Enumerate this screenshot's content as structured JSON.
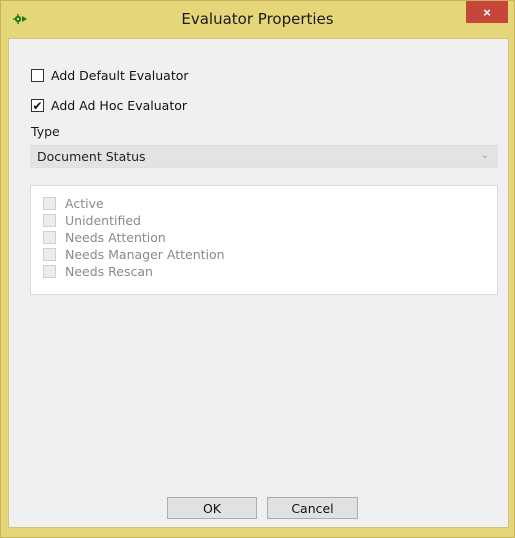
{
  "window": {
    "title": "Evaluator Properties",
    "close_label": "×"
  },
  "options": {
    "add_default_label": "Add Default Evaluator",
    "add_default_checked": false,
    "add_adhoc_label": "Add Ad Hoc Evaluator",
    "add_adhoc_checked": true,
    "check_mark": "✔"
  },
  "type_field": {
    "label": "Type",
    "selected": "Document Status",
    "chevron": "⌄"
  },
  "status_list": {
    "items": [
      {
        "label": "Active",
        "checked": false,
        "enabled": false
      },
      {
        "label": "Unidentified",
        "checked": false,
        "enabled": false
      },
      {
        "label": "Needs Attention",
        "checked": false,
        "enabled": false
      },
      {
        "label": "Needs Manager Attention",
        "checked": false,
        "enabled": false
      },
      {
        "label": "Needs Rescan",
        "checked": false,
        "enabled": false
      }
    ]
  },
  "buttons": {
    "ok_label": "OK",
    "cancel_label": "Cancel"
  },
  "colors": {
    "title_frame": "#e6d67a",
    "close_button": "#c7463c",
    "icon_green": "#1f7a1f"
  }
}
